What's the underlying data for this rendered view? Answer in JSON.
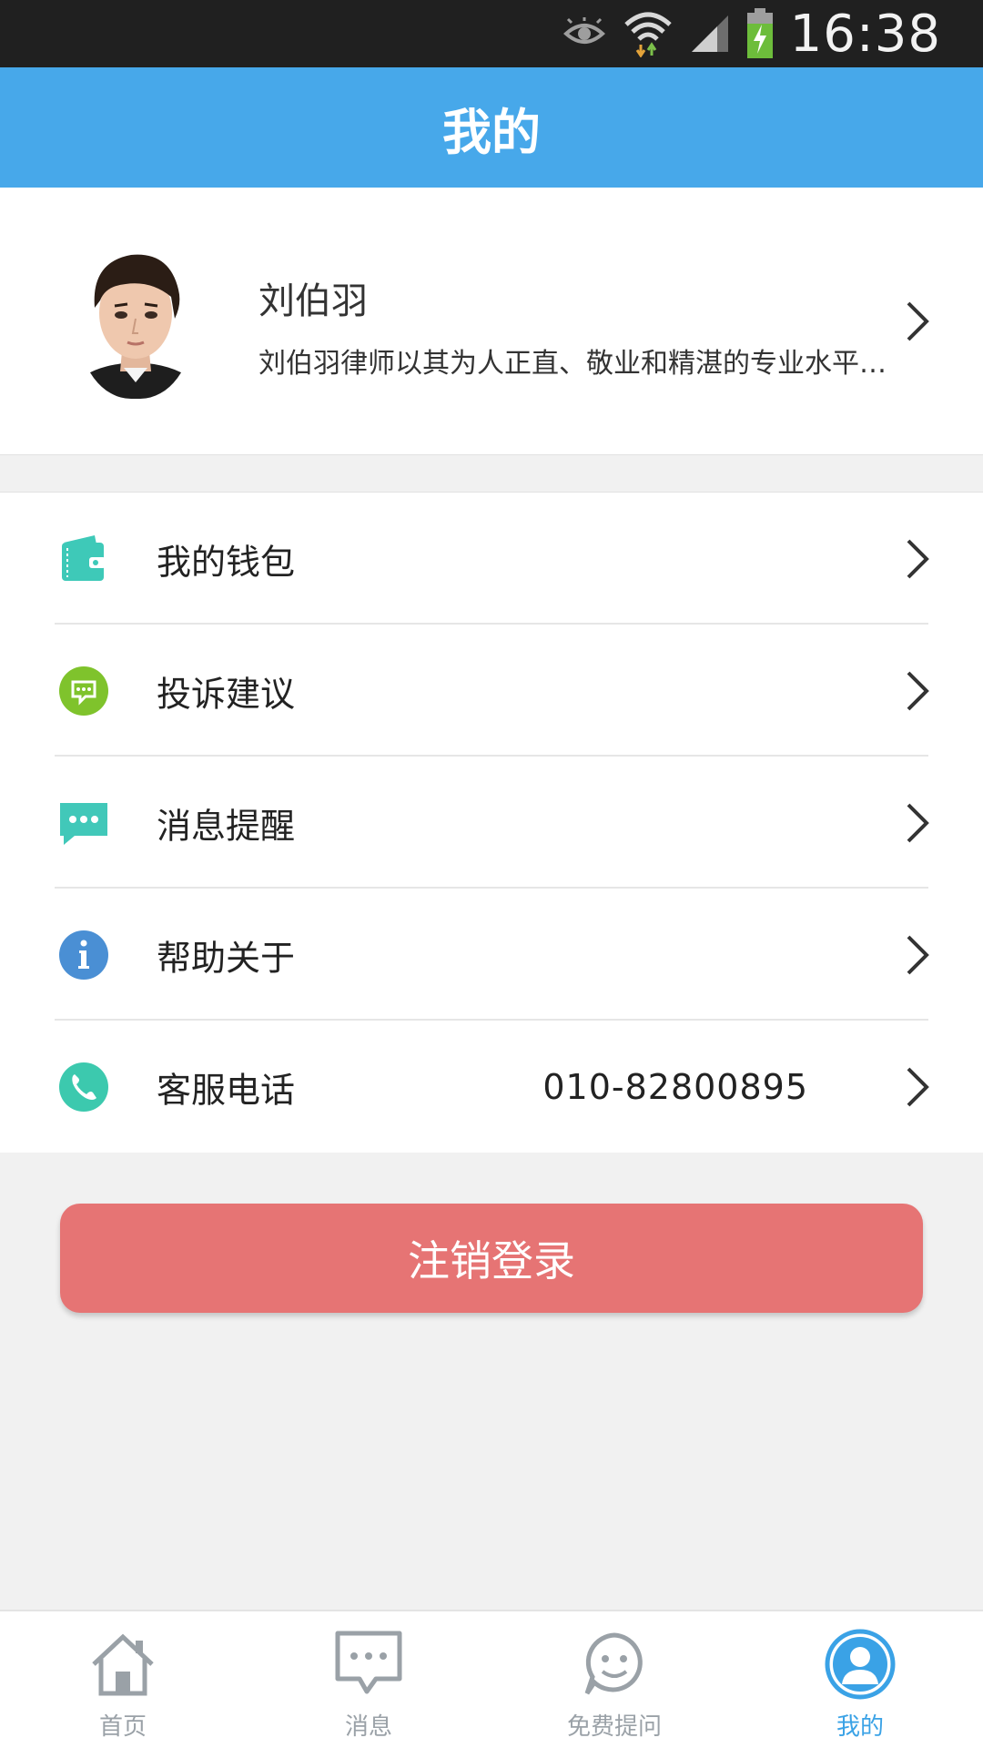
{
  "status_bar": {
    "time": "16:38"
  },
  "header": {
    "title": "我的"
  },
  "profile": {
    "name": "刘伯羽",
    "description": "刘伯羽律师以其为人正直、敬业和精湛的专业水平…"
  },
  "menu": {
    "items": [
      {
        "label": "我的钱包",
        "icon": "wallet-icon",
        "color": "#3ec9b8"
      },
      {
        "label": "投诉建议",
        "icon": "chat-bubble-icon",
        "color": "#7fc32c"
      },
      {
        "label": "消息提醒",
        "icon": "message-icon",
        "color": "#41c8b9"
      },
      {
        "label": "帮助关于",
        "icon": "info-icon",
        "color": "#4a8fd4"
      },
      {
        "label": "客服电话",
        "icon": "phone-icon",
        "color": "#3cc9ae",
        "value": "010-82800895"
      }
    ]
  },
  "logout": {
    "label": "注销登录",
    "color": "#e67474"
  },
  "bottom_nav": {
    "items": [
      {
        "label": "首页",
        "icon": "home-icon"
      },
      {
        "label": "消息",
        "icon": "message-icon"
      },
      {
        "label": "免费提问",
        "icon": "smiley-icon"
      },
      {
        "label": "我的",
        "icon": "user-icon",
        "active": true
      }
    ]
  },
  "colors": {
    "header": "#47a8ea",
    "accent": "#3aa2e6",
    "inactive_nav": "#9aa1a7"
  }
}
